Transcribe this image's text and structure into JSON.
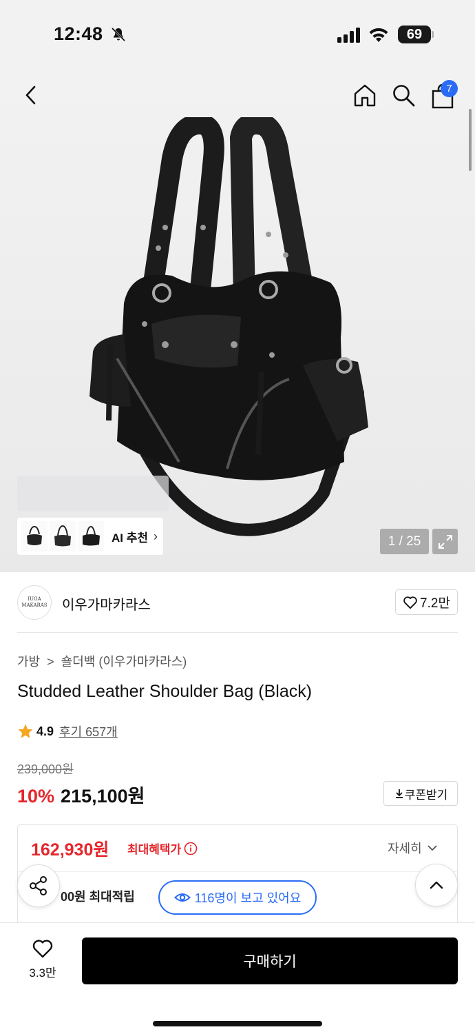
{
  "status_bar": {
    "time": "12:48",
    "battery": "69",
    "icons": [
      "bell-slash-icon",
      "signal-icon",
      "wifi-icon",
      "battery-icon"
    ]
  },
  "nav": {
    "cart_count": "7",
    "icons": [
      "back-icon",
      "home-icon",
      "search-icon",
      "cart-icon"
    ],
    "badge_color": "#2a6cf6"
  },
  "gallery": {
    "ai_label": "AI 추천",
    "counter": "1 / 25"
  },
  "brand": {
    "logo_line1": "IUGA",
    "logo_line2": "MAKARAS",
    "name": "이우가마카라스",
    "likes": "7.2만"
  },
  "product": {
    "breadcrumb_1": "가방",
    "breadcrumb_2": "숄더백 (이우가마카라스)",
    "title": "Studded Leather Shoulder Bag (Black)",
    "rating": "4.9",
    "review_text": "후기 657개",
    "original_price": "239,000원",
    "discount": "10%",
    "sale_price": "215,100원",
    "coupon_label": "쿠폰받기"
  },
  "benefit": {
    "max_price": "162,930원",
    "max_label": "최대혜택가",
    "detail_label": "자세히",
    "points_text": "00원 최대적립",
    "accent_color": "#e5262c"
  },
  "floating": {
    "viewers": "116명이 보고 있어요"
  },
  "bottom_bar": {
    "wish_count": "3.3만",
    "buy_label": "구매하기"
  }
}
